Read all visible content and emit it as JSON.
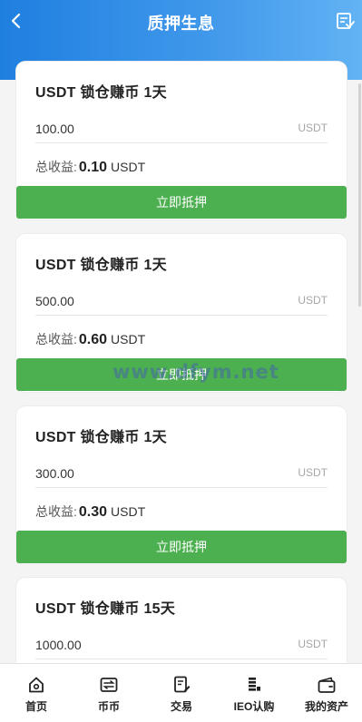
{
  "header": {
    "title": "质押生息"
  },
  "cards": [
    {
      "title": "USDT 锁仓赚币 1天",
      "amount": "100.00",
      "unit": "USDT",
      "income_label": "总收益:",
      "income_value": "0.10",
      "income_unit": "USDT",
      "button": "立即抵押"
    },
    {
      "title": "USDT 锁仓赚币 1天",
      "amount": "500.00",
      "unit": "USDT",
      "income_label": "总收益:",
      "income_value": "0.60",
      "income_unit": "USDT",
      "button": "立即抵押"
    },
    {
      "title": "USDT 锁仓赚币 1天",
      "amount": "300.00",
      "unit": "USDT",
      "income_label": "总收益:",
      "income_value": "0.30",
      "income_unit": "USDT",
      "button": "立即抵押"
    },
    {
      "title": "USDT 锁仓赚币 15天",
      "amount": "1000.00",
      "unit": "USDT"
    }
  ],
  "watermark": "www.dfym.net",
  "tabbar": [
    {
      "label": "首页",
      "icon": "home-icon"
    },
    {
      "label": "币币",
      "icon": "exchange-icon"
    },
    {
      "label": "交易",
      "icon": "trade-icon"
    },
    {
      "label": "IEO认购",
      "icon": "ieo-icon"
    },
    {
      "label": "我的资产",
      "icon": "wallet-icon"
    }
  ],
  "colors": {
    "header_start": "#1f7fe0",
    "header_end": "#62b3f4",
    "button": "#4caf50"
  }
}
